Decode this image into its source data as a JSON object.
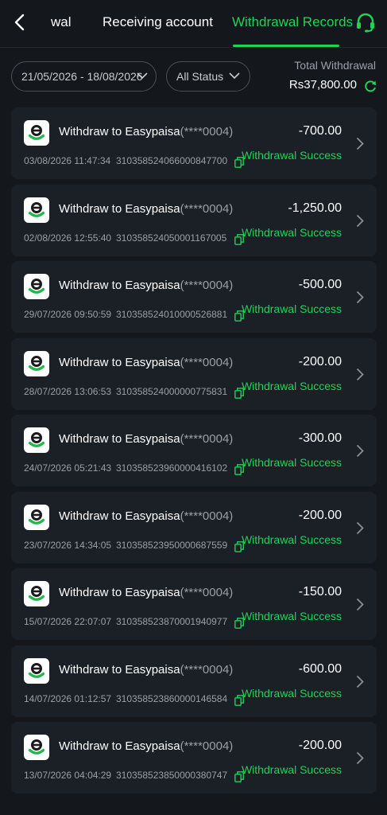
{
  "header": {
    "tabs": [
      {
        "label": "wal"
      },
      {
        "label": "Receiving account"
      },
      {
        "label": "Withdrawal Records"
      }
    ],
    "active_color": "#1fd357"
  },
  "filters": {
    "date_range": "21/05/2026 - 18/08/2026",
    "status": "All Status"
  },
  "summary": {
    "label": "Total Withdrawal",
    "amount": "Rs37,800.00"
  },
  "records": [
    {
      "title": "Withdraw to Easypaisa",
      "mask": "(****0004)",
      "amount": "-700.00",
      "time": "03/08/2026 11:47:34",
      "id": "310358524066000847700",
      "status": "Withdrawal Success"
    },
    {
      "title": "Withdraw to Easypaisa",
      "mask": "(****0004)",
      "amount": "-1,250.00",
      "time": "02/08/2026 12:55:40",
      "id": "310358524050001167005",
      "status": "Withdrawal Success"
    },
    {
      "title": "Withdraw to Easypaisa",
      "mask": "(****0004)",
      "amount": "-500.00",
      "time": "29/07/2026 09:50:59",
      "id": "310358524010000526881",
      "status": "Withdrawal Success"
    },
    {
      "title": "Withdraw to Easypaisa",
      "mask": "(****0004)",
      "amount": "-200.00",
      "time": "28/07/2026 13:06:53",
      "id": "310358524000000775831",
      "status": "Withdrawal Success"
    },
    {
      "title": "Withdraw to Easypaisa",
      "mask": "(****0004)",
      "amount": "-300.00",
      "time": "24/07/2026 05:21:43",
      "id": "310358523960000416102",
      "status": "Withdrawal Success"
    },
    {
      "title": "Withdraw to Easypaisa",
      "mask": "(****0004)",
      "amount": "-200.00",
      "time": "23/07/2026 14:34:05",
      "id": "310358523950000687559",
      "status": "Withdrawal Success"
    },
    {
      "title": "Withdraw to Easypaisa",
      "mask": "(****0004)",
      "amount": "-150.00",
      "time": "15/07/2026 22:07:07",
      "id": "310358523870001940977",
      "status": "Withdrawal Success"
    },
    {
      "title": "Withdraw to Easypaisa",
      "mask": "(****0004)",
      "amount": "-600.00",
      "time": "14/07/2026 01:12:57",
      "id": "310358523860000146584",
      "status": "Withdrawal Success"
    },
    {
      "title": "Withdraw to Easypaisa",
      "mask": "(****0004)",
      "amount": "-200.00",
      "time": "13/07/2026 04:04:29",
      "id": "310358523850000380747",
      "status": "Withdrawal Success"
    }
  ],
  "icons": {
    "back": "chevron-left-icon",
    "support": "headset-icon",
    "refresh": "refresh-icon",
    "logo": "easypaisa-logo",
    "copy": "copy-icon",
    "detail": "chevron-right-icon"
  }
}
